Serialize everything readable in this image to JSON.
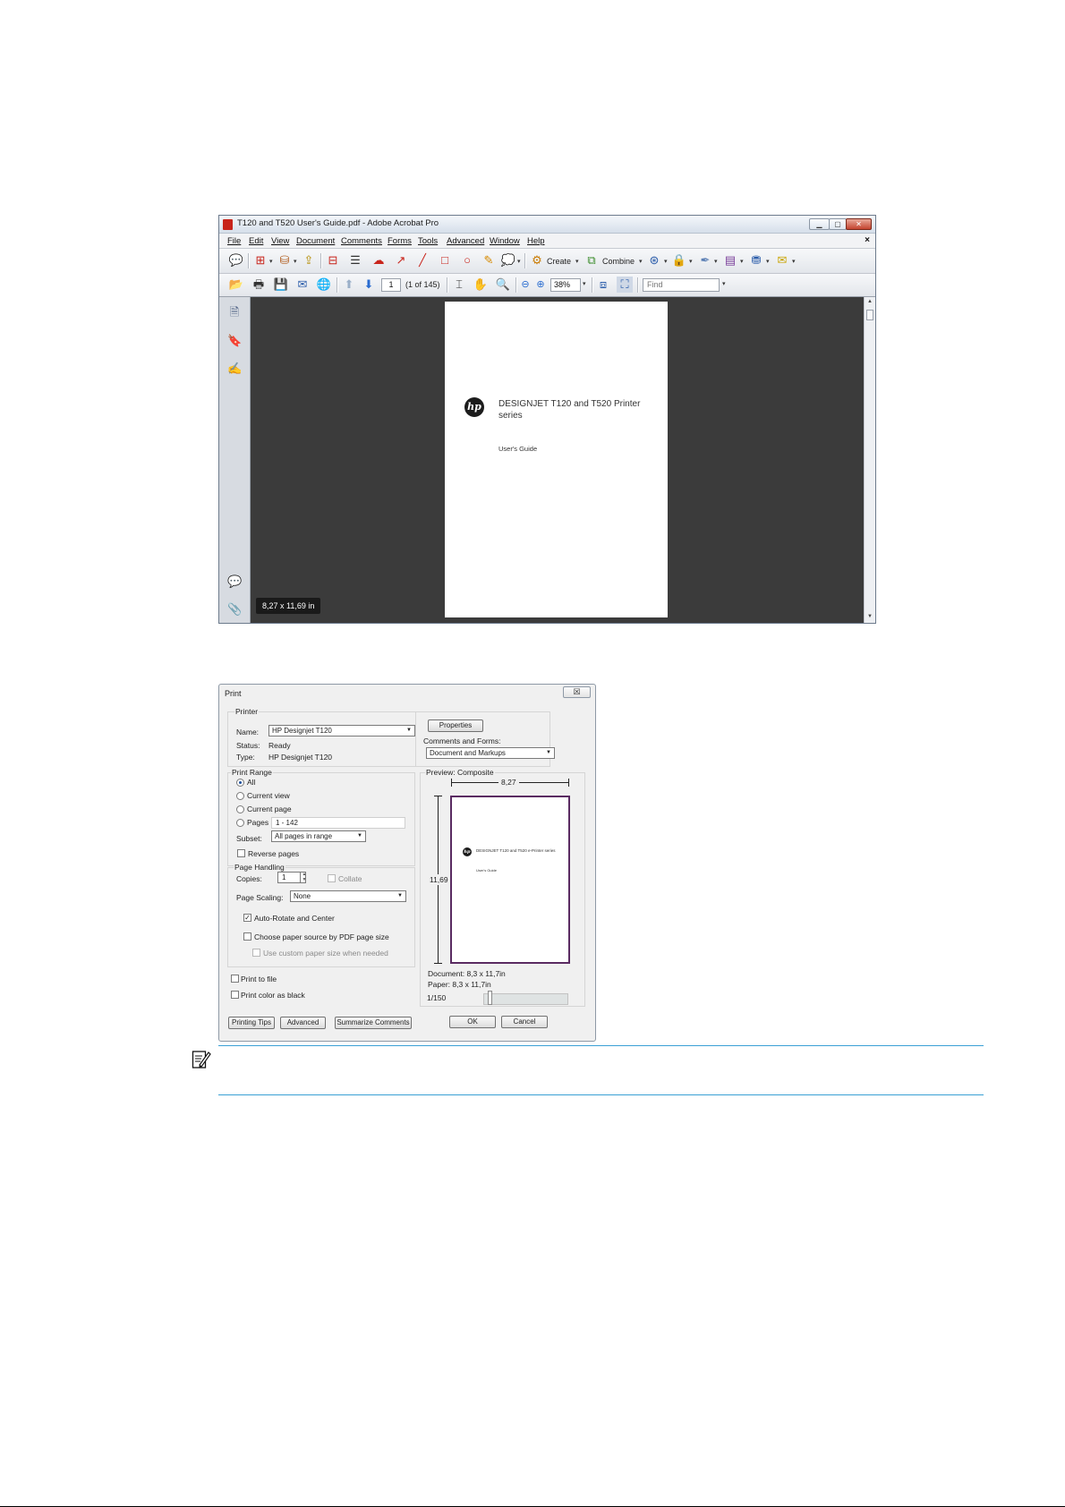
{
  "acrobat": {
    "title": "T120 and T520 User's Guide.pdf - Adobe Acrobat Pro",
    "window_buttons": [
      "minimize-icon",
      "maximize-icon",
      "close-icon"
    ],
    "menu": [
      "File",
      "Edit",
      "View",
      "Document",
      "Comments",
      "Forms",
      "Tools",
      "Advanced",
      "Window",
      "Help"
    ],
    "menu_close": "×",
    "toolbar": {
      "create_label": "Create",
      "combine_label": "Combine",
      "page_number": "1",
      "page_count": "(1 of 145)",
      "zoom": "38%",
      "find_placeholder": "Find"
    },
    "document": {
      "logo_text": "hp",
      "title": "DESIGNJET T120 and T520 Printer series",
      "subtitle": "User's Guide",
      "page_size": "8,27 x 11,69 in"
    }
  },
  "print_dialog": {
    "title": "Print",
    "close": "☒",
    "printer": {
      "group_label": "Printer",
      "name_label": "Name:",
      "name_value": "HP Designjet T120",
      "status_label": "Status:",
      "status_value": "Ready",
      "type_label": "Type:",
      "type_value": "HP Designjet T120",
      "properties_button": "Properties",
      "comments_forms_label": "Comments and Forms:",
      "comments_forms_value": "Document and Markups"
    },
    "print_range": {
      "group_label": "Print Range",
      "options": [
        "All",
        "Current view",
        "Current page",
        "Pages"
      ],
      "selected": "All",
      "pages_value": "1 - 142",
      "subset_label": "Subset:",
      "subset_value": "All pages in range",
      "reverse_label": "Reverse pages"
    },
    "page_handling": {
      "group_label": "Page Handling",
      "copies_label": "Copies:",
      "copies_value": "1",
      "collate_label": "Collate",
      "scaling_label": "Page Scaling:",
      "scaling_value": "None",
      "auto_rotate_label": "Auto-Rotate and Center",
      "auto_rotate_checked": true,
      "paper_source_label": "Choose paper source by PDF page size",
      "custom_paper_label": "Use custom paper size when needed"
    },
    "print_to_file_label": "Print to file",
    "print_color_black_label": "Print color as black",
    "preview": {
      "group_label": "Preview: Composite",
      "width_label": "8,27",
      "height_label": "11,69",
      "document_size": "Document: 8,3 x 11,7in",
      "paper_size": "Paper: 8,3 x 11,7in",
      "page_indicator": "1/150",
      "mini_title": "DESIGNJET T120 and T520 e-Printer series",
      "mini_subtitle": "User's Guide"
    },
    "buttons": {
      "printing_tips": "Printing Tips",
      "advanced": "Advanced",
      "summarize": "Summarize Comments",
      "ok": "OK",
      "cancel": "Cancel"
    }
  },
  "note": {
    "icon": "note-pencil-icon"
  },
  "colors": {
    "note_rule": "#3aa0d5",
    "doc_background": "#3b3b3b",
    "preview_border": "#5a2b62"
  }
}
